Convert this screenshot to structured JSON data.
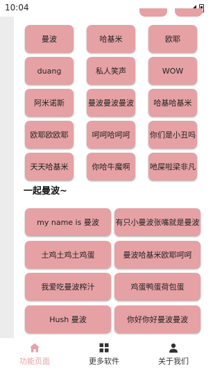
{
  "status": {
    "time": "10:04"
  },
  "grid_buttons": [
    "曼波",
    "哈基米",
    "欧耶",
    "duang",
    "私人笑声",
    "WOW",
    "阿米诺斯",
    "曼波曼波曼波",
    "哈基哈基米",
    "欧耶欧欧耶",
    "呵呵哈呵呵",
    "你们是小丑吗",
    "天天哈基米",
    "你哈牛魔啊",
    "吔屎啦梁非凡"
  ],
  "section_title": "一起曼波~",
  "wide_buttons": [
    "my name is 曼波",
    "有只小曼波张嘴就是曼波",
    "土鸡土鸡土鸡蛋",
    "曼波哈基米欧耶呵呵",
    "我爱吃曼波榨汁",
    "鸡蛋鸭蛋荷包蛋",
    "Hush 曼波",
    "你好你好曼波曼波"
  ],
  "nav": {
    "items": [
      {
        "label": "功能页面",
        "icon": "home-icon",
        "active": true
      },
      {
        "label": "更多软件",
        "icon": "grid-icon",
        "active": false
      },
      {
        "label": "关于我们",
        "icon": "person-icon",
        "active": false
      }
    ]
  },
  "colors": {
    "button": "#e6a1a4",
    "active_nav": "#e6a1a4",
    "strip": "#ececec"
  }
}
